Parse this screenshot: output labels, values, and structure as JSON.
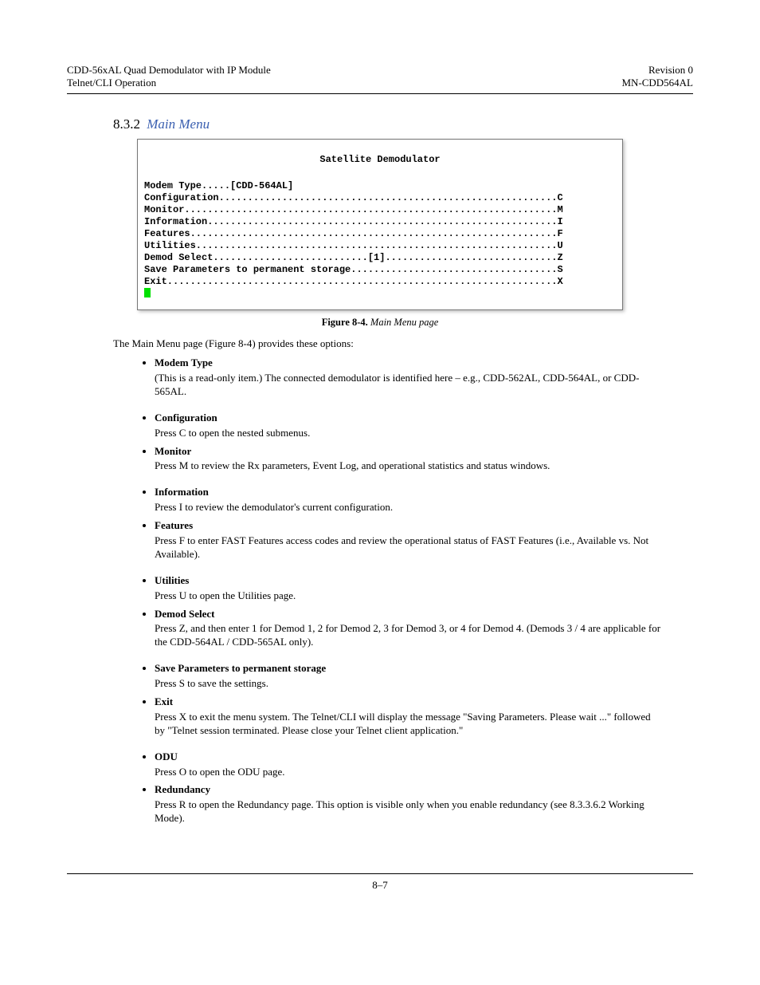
{
  "header": {
    "left1": "CDD-56xAL Quad Demodulator with IP Module",
    "left2": "Telnet/CLI Operation",
    "right1": "Revision 0",
    "right2": "MN-CDD564AL"
  },
  "section": {
    "num": "8.3.2",
    "title": "Main Menu"
  },
  "terminal": {
    "title": "Satellite Demodulator",
    "lines": [
      "Modem Type.....[CDD-564AL]",
      "Configuration...........................................................C",
      "Monitor.................................................................M",
      "Information.............................................................I",
      "Features................................................................F",
      "Utilities...............................................................U",
      "",
      "",
      "Demod Select...........................[1]..............................Z",
      "Save Parameters to permanent storage....................................S",
      "Exit....................................................................X"
    ]
  },
  "figure": {
    "num": "Figure 8-4.",
    "caption": "Main Menu page"
  },
  "intro": "The Main Menu page (Figure 8-4) provides these options:",
  "items": [
    {
      "label": "Modem Type",
      "desc": "(This is a read-only item.) The connected demodulator is identified here – e.g., CDD-562AL, CDD-564AL, or CDD-565AL."
    },
    {
      "label": "Configuration",
      "desc": "Press C to open the nested submenus."
    },
    {
      "label": "Monitor",
      "desc": "Press M to review the Rx parameters, Event Log, and operational statistics and status windows."
    },
    {
      "label": "Information",
      "desc": "Press I to review the demodulator's current configuration."
    },
    {
      "label": "Features",
      "desc": "Press F to enter FAST Features access codes and review the operational status of FAST Features (i.e., Available vs. Not Available)."
    },
    {
      "label": "Utilities",
      "desc": "Press U to open the Utilities page."
    },
    {
      "label": "Demod Select",
      "desc": "Press Z, and then enter 1 for Demod 1, 2 for Demod 2, 3 for Demod 3, or 4 for Demod 4. (Demods 3 / 4 are applicable for the CDD-564AL / CDD-565AL only)."
    },
    {
      "label": "Save Parameters to permanent storage",
      "desc": "Press S to save the settings."
    },
    {
      "label": "Exit",
      "desc": "Press X to exit the menu system. The Telnet/CLI will display the message \"Saving Parameters. Please wait ...\" followed by \"Telnet session terminated. Please close your Telnet client application.\""
    },
    {
      "label": "ODU",
      "desc": "Press O to open the ODU page."
    },
    {
      "label": "Redundancy",
      "desc": "Press R to open the Redundancy page. This option is visible only when you enable redundancy (see 8.3.3.6.2 Working Mode)."
    }
  ],
  "footer": "8–7"
}
